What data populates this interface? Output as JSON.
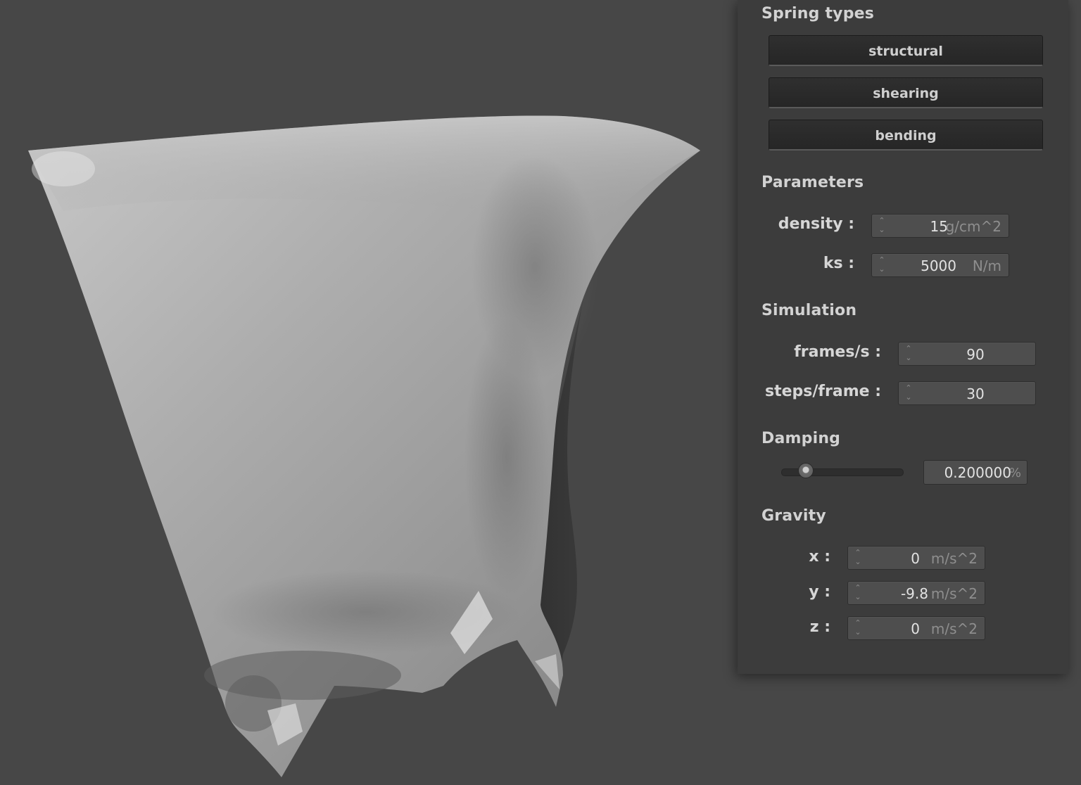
{
  "panel": {
    "spring_types": {
      "title": "Spring types",
      "buttons": [
        "structural",
        "shearing",
        "bending"
      ]
    },
    "parameters": {
      "title": "Parameters",
      "density": {
        "label": "density :",
        "value": "15",
        "unit": "g/cm^2"
      },
      "ks": {
        "label": "ks :",
        "value": "5000",
        "unit": "N/m"
      }
    },
    "simulation": {
      "title": "Simulation",
      "fps": {
        "label": "frames/s :",
        "value": "90"
      },
      "steps": {
        "label": "steps/frame :",
        "value": "30"
      }
    },
    "damping": {
      "title": "Damping",
      "slider_fraction": 0.2,
      "value": "0.200000",
      "unit": "%"
    },
    "gravity": {
      "title": "Gravity",
      "x": {
        "label": "x :",
        "value": "0",
        "unit": "m/s^2"
      },
      "y": {
        "label": "y :",
        "value": "-9.8",
        "unit": "m/s^2"
      },
      "z": {
        "label": "z :",
        "value": "0",
        "unit": "m/s^2"
      }
    }
  },
  "colors": {
    "background": "#474747",
    "panel": "#3c3c3c",
    "cloth": "#a8a8a8"
  }
}
